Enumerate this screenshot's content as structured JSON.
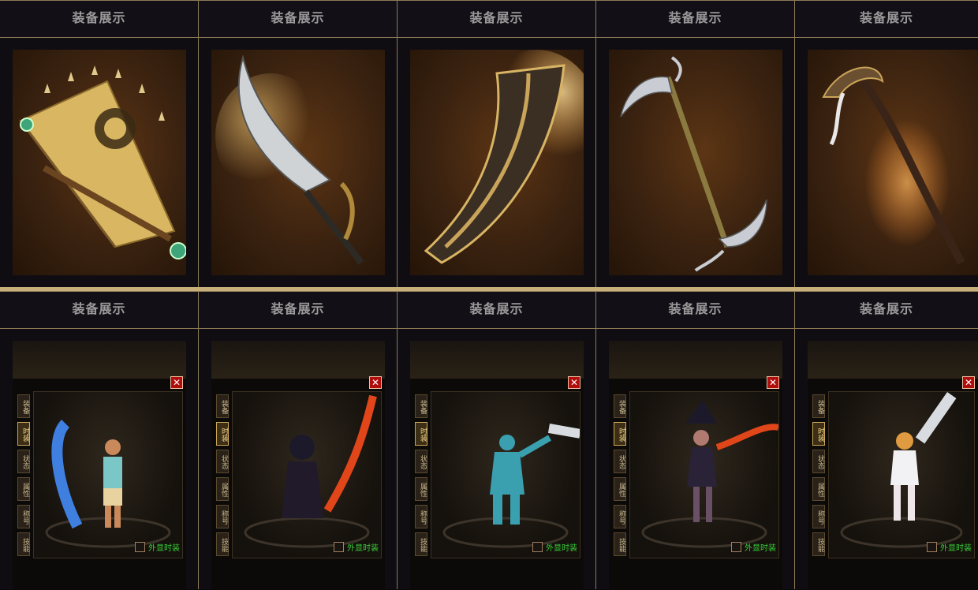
{
  "cell_title": "装备展示",
  "weapons": [
    {
      "icon": "folding-fan-icon"
    },
    {
      "icon": "curved-blade-icon"
    },
    {
      "icon": "broad-sword-icon"
    },
    {
      "icon": "double-scythe-icon"
    },
    {
      "icon": "dragon-staff-icon"
    }
  ],
  "character_panel": {
    "close_label": "✕",
    "tabs": [
      "装备",
      "时装",
      "状态",
      "属性",
      "称号",
      "技能"
    ],
    "active_tab": "时装",
    "show_fashion_label": "外显时装"
  },
  "characters": [
    {
      "icon": "shark-weapon-character-icon"
    },
    {
      "icon": "flame-blade-character-icon"
    },
    {
      "icon": "syringe-doctor-character-icon"
    },
    {
      "icon": "witch-flame-character-icon"
    },
    {
      "icon": "nurse-syringe-character-icon"
    }
  ],
  "colors": {
    "gold_border": "#8d7a55",
    "separator": "#c9b07a",
    "close_red": "#b00d0d",
    "label_green": "#39d23a"
  }
}
